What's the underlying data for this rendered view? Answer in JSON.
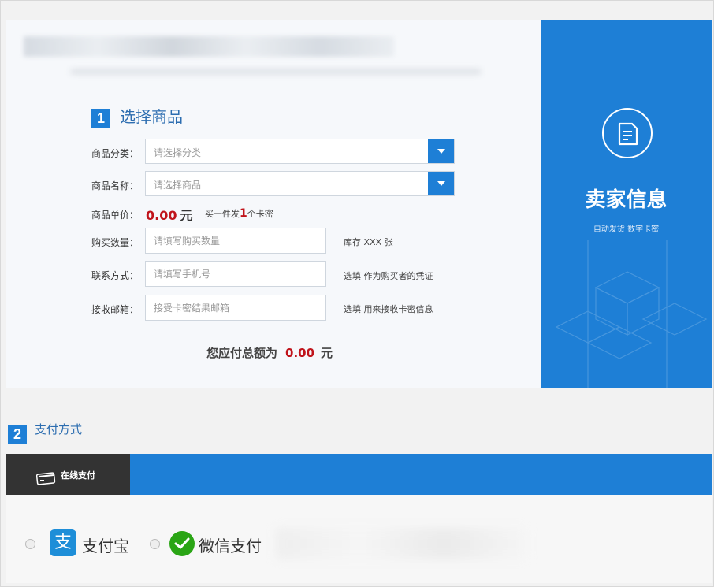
{
  "section1": {
    "step": "1",
    "title": "选择商品",
    "category": {
      "label": "商品分类：",
      "placeholder": "请选择分类"
    },
    "product": {
      "label": "商品名称：",
      "placeholder": "请选择商品"
    },
    "unit_price": {
      "label": "商品单价：",
      "value": "0.00",
      "unit": "元",
      "note_prefix": "买一件发",
      "note_count": "1",
      "note_suffix": "个卡密"
    },
    "quantity": {
      "label": "购买数量：",
      "placeholder": "请填写购买数量",
      "hint": "库存 XXX 张"
    },
    "contact": {
      "label": "联系方式：",
      "placeholder": "请填写手机号",
      "hint": "选填 作为购买者的凭证"
    },
    "email": {
      "label": "接收邮箱：",
      "placeholder": "接受卡密结果邮箱",
      "hint": "选填 用来接收卡密信息"
    },
    "total": {
      "label": "您应付总额为",
      "value": "0.00",
      "unit": "元"
    }
  },
  "seller": {
    "icon": "document-icon",
    "title": "卖家信息",
    "subtitle": "自动发货   数字卡密"
  },
  "section2": {
    "step": "2",
    "title": "支付方式",
    "tab": {
      "label": "在线支付",
      "icon": "card-icon"
    },
    "options": [
      {
        "name": "支付宝",
        "logo": "alipay-logo",
        "logo_char": "支"
      },
      {
        "name": "微信支付",
        "logo": "wechat-pay-logo"
      }
    ]
  },
  "colors": {
    "primary": "#1e7fd6",
    "price_red": "#c0141b",
    "tab_dark": "#333333"
  }
}
